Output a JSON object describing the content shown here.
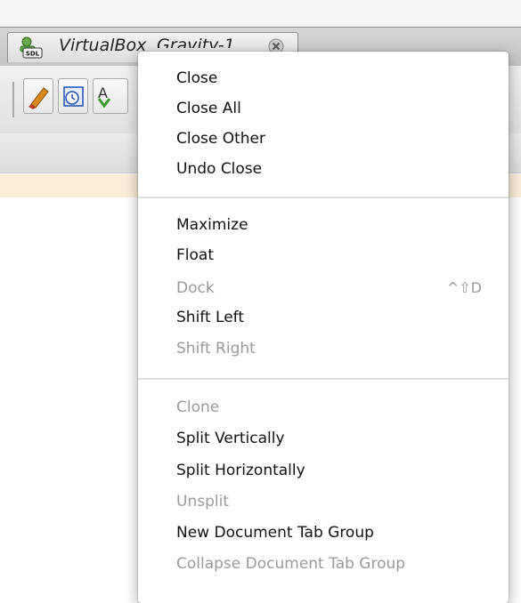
{
  "tab": {
    "title_visible": "VirtualBox",
    "title_cut": "Gravity-1"
  },
  "toolbar": {
    "partial_char": "A"
  },
  "menu": {
    "items": [
      {
        "label": "Close",
        "enabled": true,
        "shortcut": ""
      },
      {
        "label": "Close All",
        "enabled": true,
        "shortcut": ""
      },
      {
        "label": "Close Other",
        "enabled": true,
        "shortcut": ""
      },
      {
        "label": "Undo Close",
        "enabled": true,
        "shortcut": ""
      },
      {
        "label": "Maximize",
        "enabled": true,
        "shortcut": ""
      },
      {
        "label": "Float",
        "enabled": true,
        "shortcut": ""
      },
      {
        "label": "Dock",
        "enabled": false,
        "shortcut": "^⇧D"
      },
      {
        "label": "Shift Left",
        "enabled": true,
        "shortcut": ""
      },
      {
        "label": "Shift Right",
        "enabled": false,
        "shortcut": ""
      },
      {
        "label": "Clone",
        "enabled": false,
        "shortcut": ""
      },
      {
        "label": "Split Vertically",
        "enabled": true,
        "shortcut": ""
      },
      {
        "label": "Split Horizontally",
        "enabled": true,
        "shortcut": ""
      },
      {
        "label": "Unsplit",
        "enabled": false,
        "shortcut": ""
      },
      {
        "label": "New Document Tab Group",
        "enabled": true,
        "shortcut": ""
      },
      {
        "label": "Collapse Document Tab Group",
        "enabled": false,
        "shortcut": ""
      }
    ]
  },
  "colors": {
    "enabled_text": "#111111",
    "disabled_text": "#9a9a9a",
    "notice_bar": "#fbeed9"
  },
  "icons": [
    "sdl-project-icon",
    "tab-close-icon",
    "eraser-icon",
    "clock-window-icon"
  ]
}
